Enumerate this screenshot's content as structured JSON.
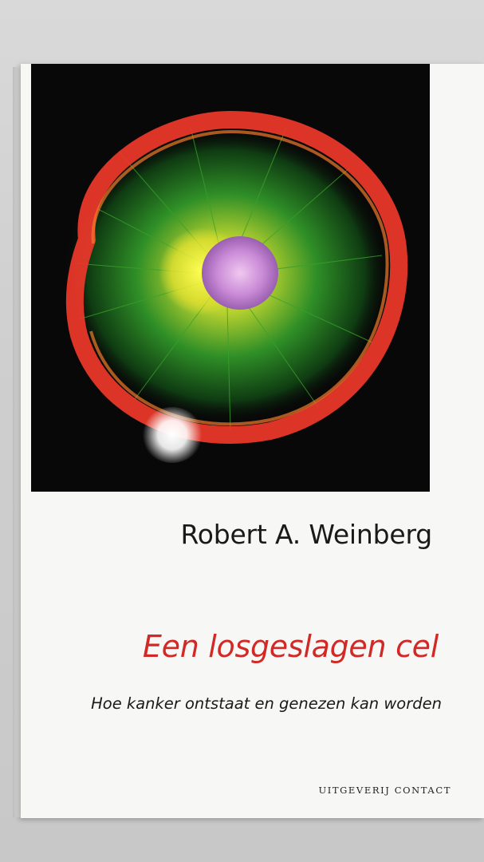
{
  "book": {
    "author": "Robert A. Weinberg",
    "title": "Een losgeslagen cel",
    "subtitle": "Hoe kanker ontstaat en genezen kan worden",
    "publisher": "UITGEVERIJ CONTACT"
  },
  "colors": {
    "title": "#d12a26",
    "cover_background": "#080808",
    "cell_ring": "#e8382a",
    "cytoskeleton": "#3aa12a",
    "nucleus": "#c98ad6"
  },
  "cover_art": "fluorescent-cell-micrograph"
}
